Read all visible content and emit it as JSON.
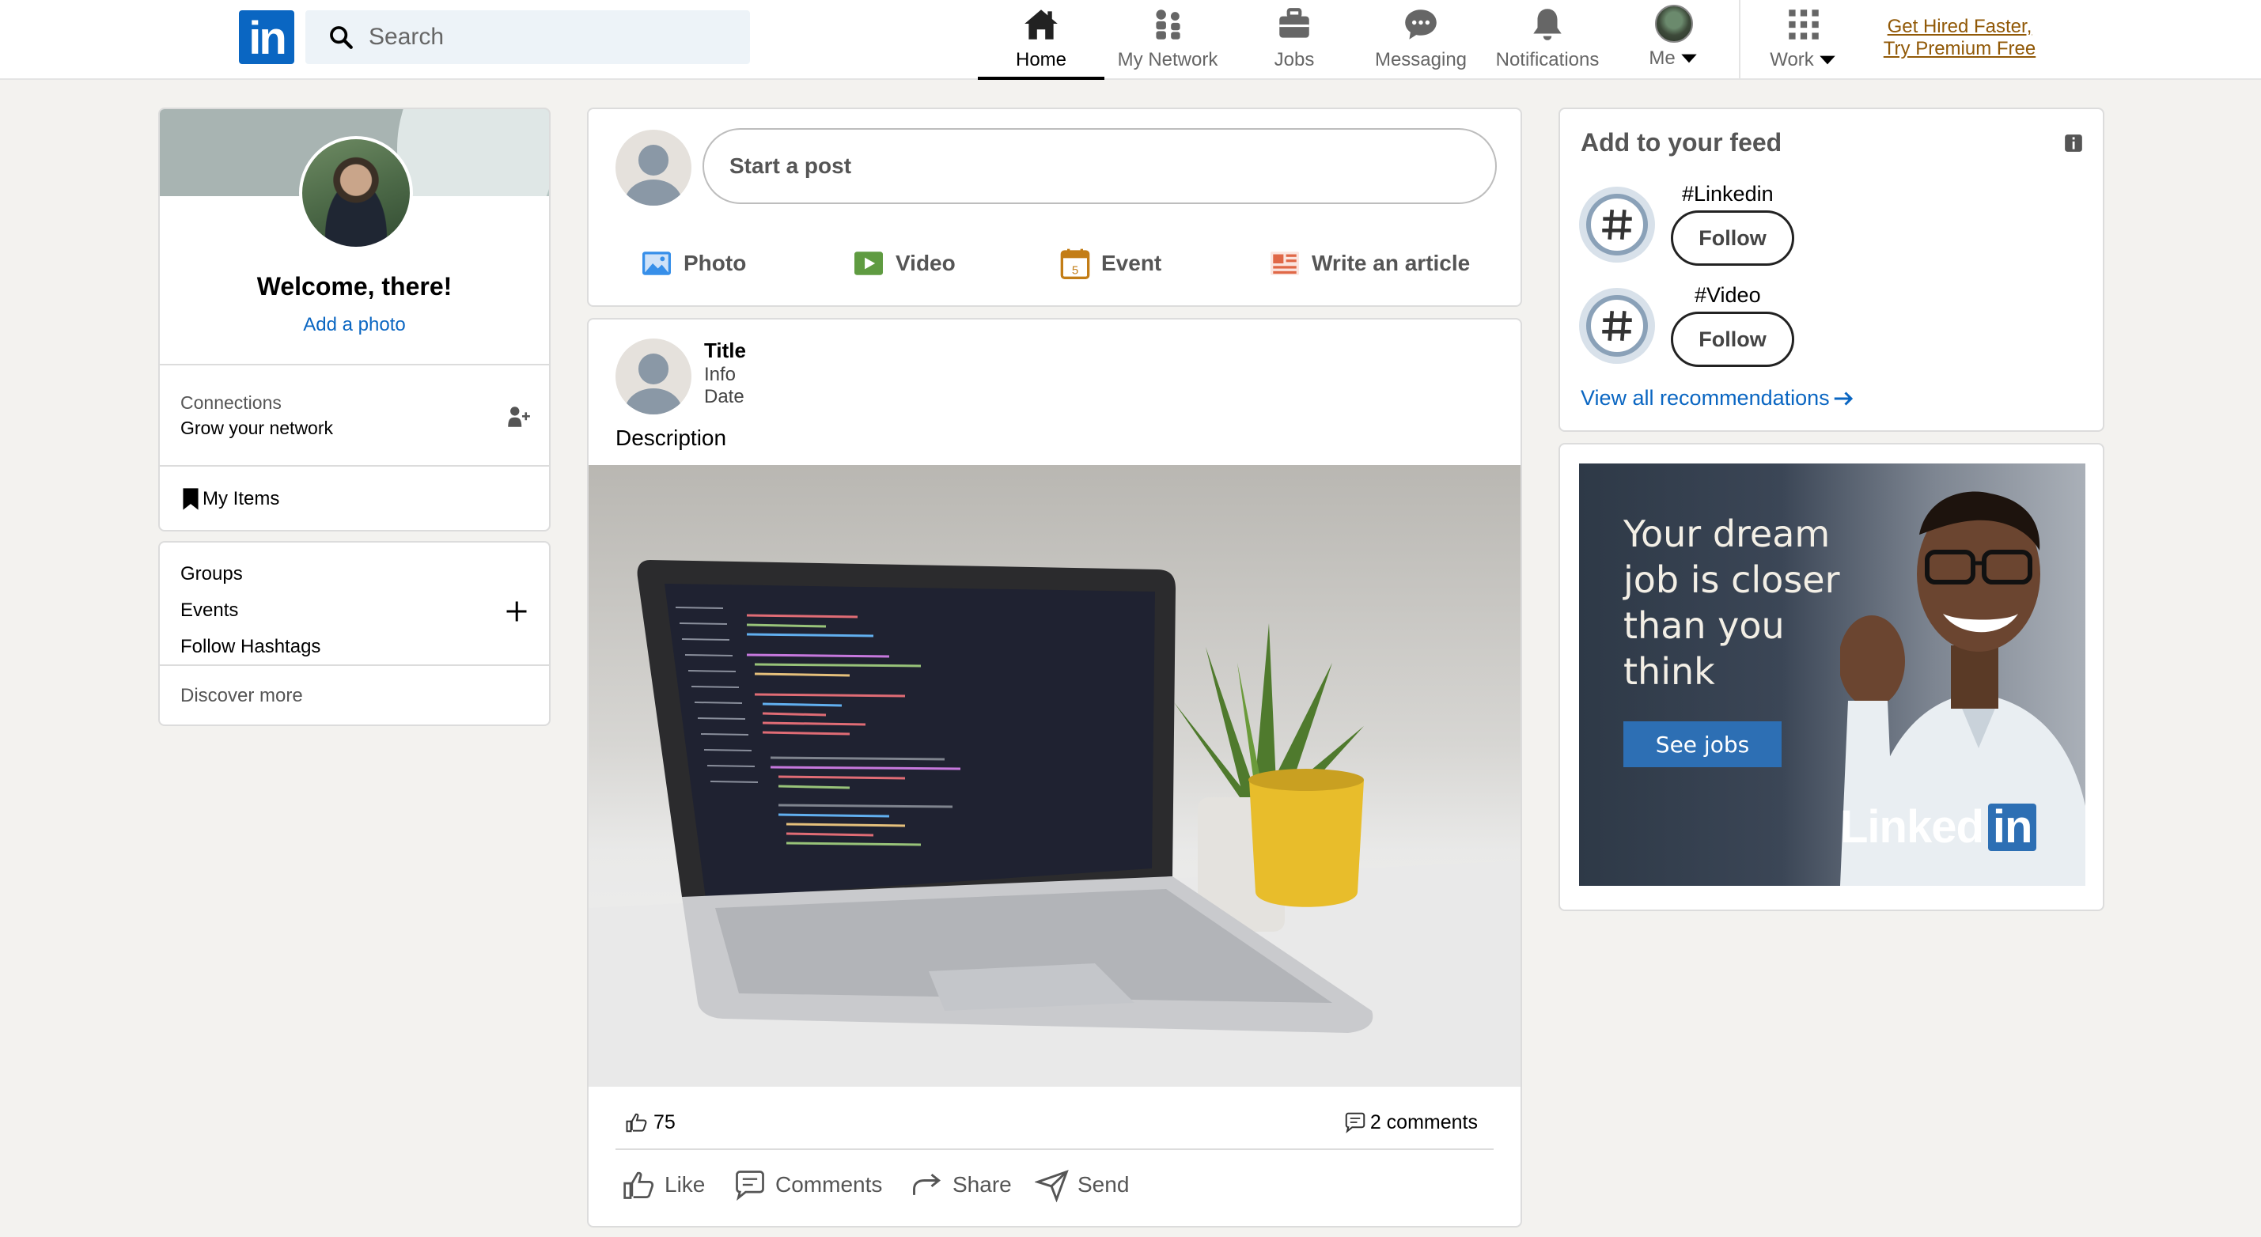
{
  "brand": {
    "logo_text": "in"
  },
  "search": {
    "placeholder": "Search"
  },
  "nav": {
    "items": [
      {
        "label": "Home",
        "icon": "home-icon",
        "active": true
      },
      {
        "label": "My Network",
        "icon": "network-icon"
      },
      {
        "label": "Jobs",
        "icon": "briefcase-icon"
      },
      {
        "label": "Messaging",
        "icon": "chat-icon"
      },
      {
        "label": "Notifications",
        "icon": "bell-icon"
      },
      {
        "label": "Me",
        "icon": "avatar"
      },
      {
        "label": "Work",
        "icon": "grid-icon"
      }
    ],
    "premium_line1": "Get Hired Faster,",
    "premium_line2": "Try Premium Free"
  },
  "profile": {
    "welcome": "Welcome, there!",
    "add_photo": "Add a photo",
    "connections_label": "Connections",
    "connections_sub": "Grow your network",
    "my_items": "My Items"
  },
  "community": {
    "groups": "Groups",
    "events": "Events",
    "follow_hashtags": "Follow Hashtags",
    "discover_more": "Discover more"
  },
  "composer": {
    "start_post": "Start a post",
    "actions": [
      {
        "label": "Photo",
        "color": "#378fe9"
      },
      {
        "label": "Video",
        "color": "#5f9b41"
      },
      {
        "label": "Event",
        "color": "#c37d16"
      },
      {
        "label": "Write an article",
        "color": "#e06847"
      }
    ]
  },
  "post": {
    "title": "Title",
    "info": "Info",
    "date": "Date",
    "description": "Description",
    "likes": "75",
    "comments_count": "2 comments",
    "actions": [
      "Like",
      "Comments",
      "Share",
      "Send"
    ]
  },
  "feed": {
    "heading": "Add to your feed",
    "items": [
      {
        "tag": "#Linkedin",
        "button": "Follow"
      },
      {
        "tag": "#Video",
        "button": "Follow"
      }
    ],
    "view_all": "View all recommendations"
  },
  "ad": {
    "headline": "Your dream job is closer than you think",
    "cta": "See jobs",
    "logo_text": "Linked",
    "logo_in": "in"
  },
  "colors": {
    "brand": "#0a66c2",
    "premium": "#915907",
    "link": "#0a66c2",
    "background": "#f3f2ef"
  }
}
